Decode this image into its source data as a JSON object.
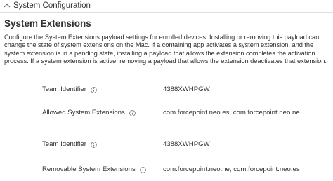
{
  "section": {
    "title": "System Configuration",
    "expanded_icon": "chevron-up-icon"
  },
  "main": {
    "title": "System Extensions",
    "description": "Configure the System Extensions payload settings for enrolled devices. Installing or removing this payload can change the state of system extensions on the Mac. If a containing app activates a system extension, and the system extension is in a pending state, installing a payload that allows the extension completes the activation process. If a system extension is active, removing a payload that allows the extension deactivates that extension."
  },
  "fields": [
    {
      "label": "Team Identifier",
      "icon": "info-icon",
      "value": "4388XWHPGW"
    },
    {
      "label": "Allowed System Extensions",
      "icon": "info-icon",
      "value": "com.forcepoint.neo.es, com.forcepoint.neo.ne"
    },
    {
      "label": "Team Identifier",
      "icon": "info-icon",
      "value": "4388XWHPGW"
    },
    {
      "label": "Removable System Extensions",
      "icon": "info-icon",
      "value": "com.forcepoint.neo.ne, com.forcepoint.neo.es"
    }
  ],
  "colors": {
    "text": "#323130",
    "divider": "#e1dfdd",
    "icon": "#605e5c"
  }
}
